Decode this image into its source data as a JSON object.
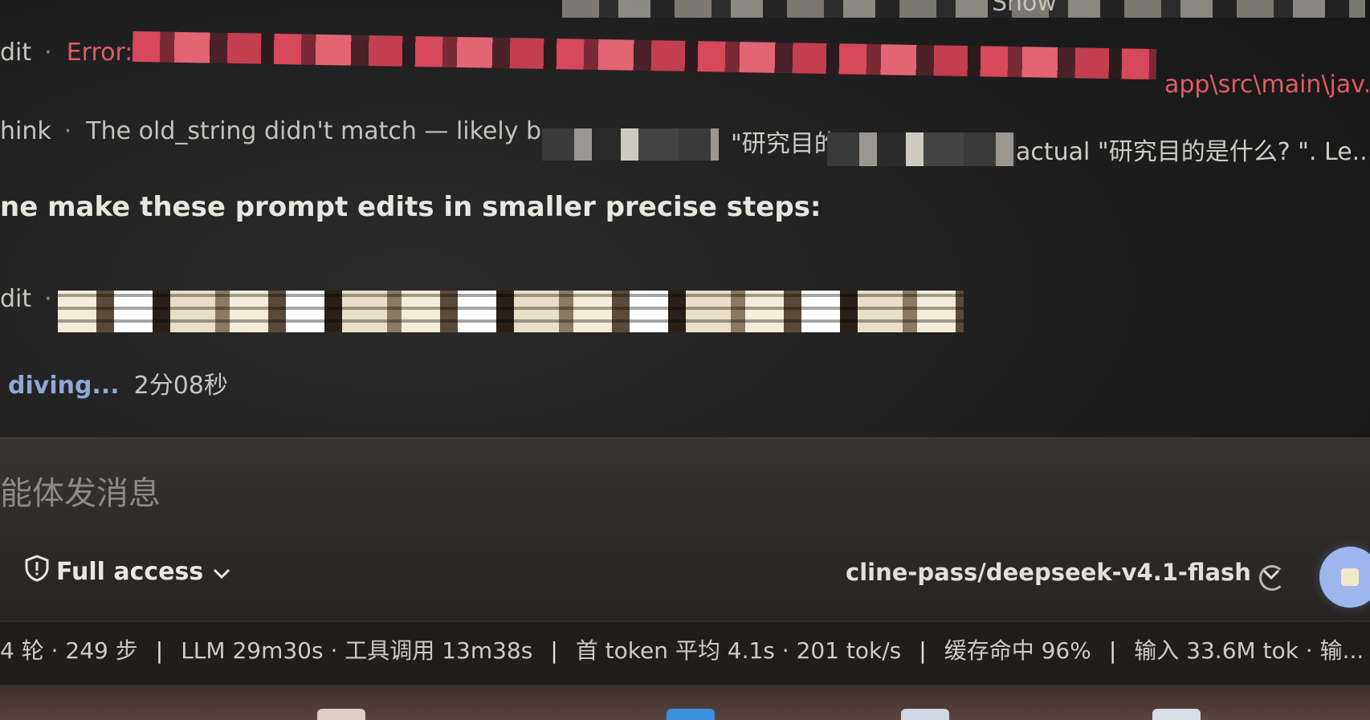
{
  "log": {
    "top_partial_text": "Show",
    "error_row": {
      "kind": "dit",
      "message": "Error: c",
      "path_fragment": "app\\src\\main\\jav..."
    },
    "think_row": {
      "kind": "hink",
      "message": "The old_string didn't match — likely b",
      "quoted": "\"研究目的",
      "actual": "actual \"研究目的是什么? \". Le..."
    },
    "plan_text": "ne make these prompt edits in smaller precise steps:",
    "edit_row": {
      "kind": "dit"
    },
    "status_row": {
      "spinner_text": "diving...",
      "elapsed": "2分08秒"
    }
  },
  "composer": {
    "placeholder": "能体发消息",
    "access_label": "Full access",
    "model_label": "cline-pass/deepseek-v4.1-flash"
  },
  "statusbar": {
    "turns_steps": "4 轮 · 249 步",
    "llm_tools": "LLM 29m30s · 工具调用 13m38s",
    "first_token": "首 token 平均 4.1s · 201 tok/s",
    "cache": "缓存命中 96%",
    "input": "输入 33.6M tok · 输..."
  },
  "colors": {
    "error": "#e25a66",
    "accent_blue": "#9db6ee",
    "background": "#1d1d1d"
  }
}
